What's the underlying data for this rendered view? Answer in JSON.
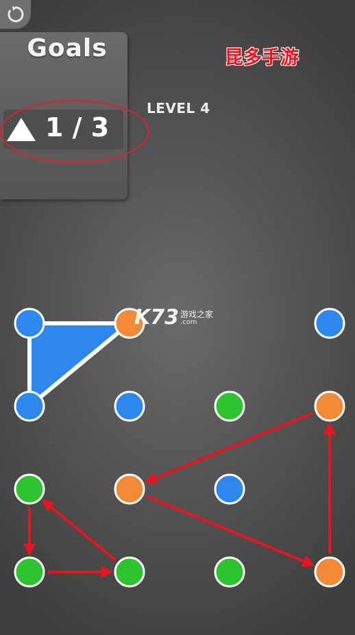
{
  "hud": {
    "restart_icon": "restart-icon",
    "goals_title": "Goals",
    "goal_shape_icon": "triangle-icon",
    "goal_progress": "1 / 3",
    "level_label": "LEVEL 4"
  },
  "watermarks": {
    "top_text": "昆多手游",
    "logo_text": "K73",
    "logo_sub": "游戏之家",
    "logo_domain": ".com"
  },
  "colors": {
    "blue": "#2d88ee",
    "green": "#2ec42f",
    "orange": "#f28a38",
    "dot_border": "#ffffff",
    "annotation_red": "#e8141f",
    "completed_shape": "#2d88ee"
  },
  "board": {
    "columns": 4,
    "rows": 4,
    "grid": [
      [
        "blue",
        "orange",
        "",
        "blue"
      ],
      [
        "blue",
        "blue",
        "green",
        "orange"
      ],
      [
        "green",
        "orange",
        "blue",
        ""
      ],
      [
        "green",
        "green",
        "green",
        "orange"
      ]
    ],
    "completed_triangles": [
      {
        "color": "blue",
        "vertices": [
          [
            0,
            0
          ],
          [
            1,
            0
          ],
          [
            0,
            1
          ]
        ]
      }
    ],
    "hint_triangles": [
      {
        "color": "green",
        "vertices": [
          [
            0,
            2
          ],
          [
            0,
            3
          ],
          [
            1,
            3
          ]
        ]
      },
      {
        "color": "orange",
        "vertices": [
          [
            3,
            1
          ],
          [
            1,
            2
          ],
          [
            3,
            3
          ]
        ]
      }
    ]
  }
}
